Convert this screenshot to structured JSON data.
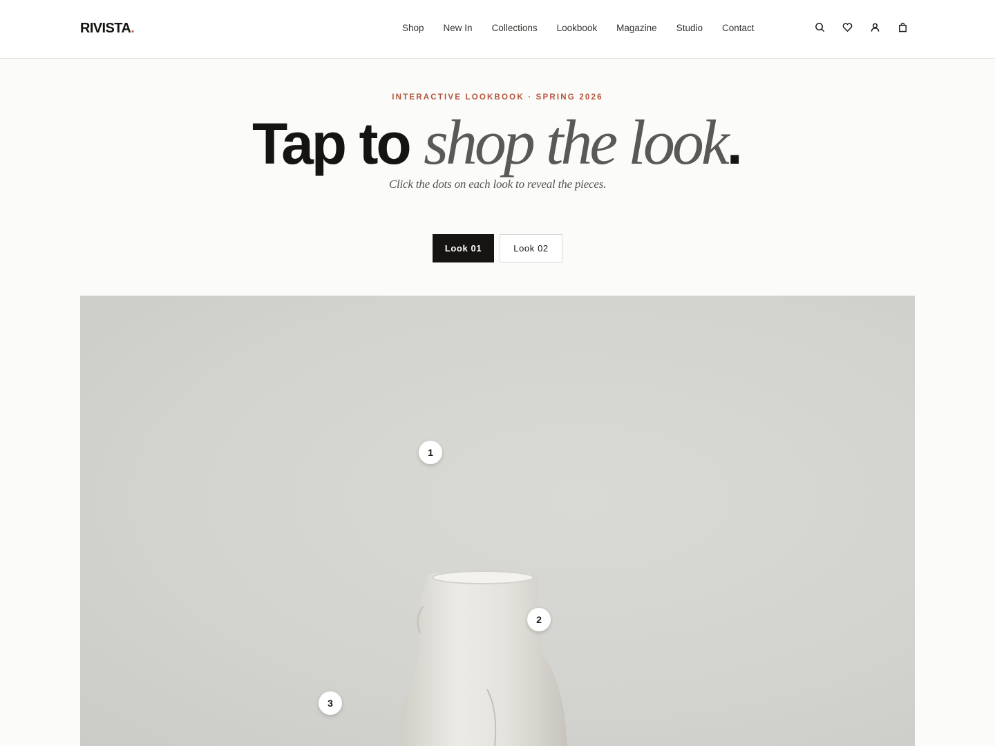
{
  "header": {
    "logo": "RIVISTA",
    "logo_dot": ".",
    "nav": [
      "Shop",
      "New In",
      "Collections",
      "Lookbook",
      "Magazine",
      "Studio",
      "Contact"
    ],
    "icons": [
      "search-icon",
      "heart-icon",
      "user-icon",
      "bag-icon"
    ]
  },
  "hero": {
    "eyebrow": "INTERACTIVE LOOKBOOK · SPRING 2026",
    "headline_bold": "Tap to ",
    "headline_italic": "shop the look",
    "headline_dot": ".",
    "subtitle": "Click the dots on each look to reveal the pieces."
  },
  "tabs": [
    {
      "label": "Look 01",
      "active": true
    },
    {
      "label": "Look 02",
      "active": false
    }
  ],
  "look": {
    "hotspots": [
      "1",
      "2",
      "3"
    ]
  },
  "colors": {
    "accent": "#c4553a",
    "eyebrow": "#b5533a",
    "dark": "#151412",
    "background": "#fbfbfa"
  }
}
